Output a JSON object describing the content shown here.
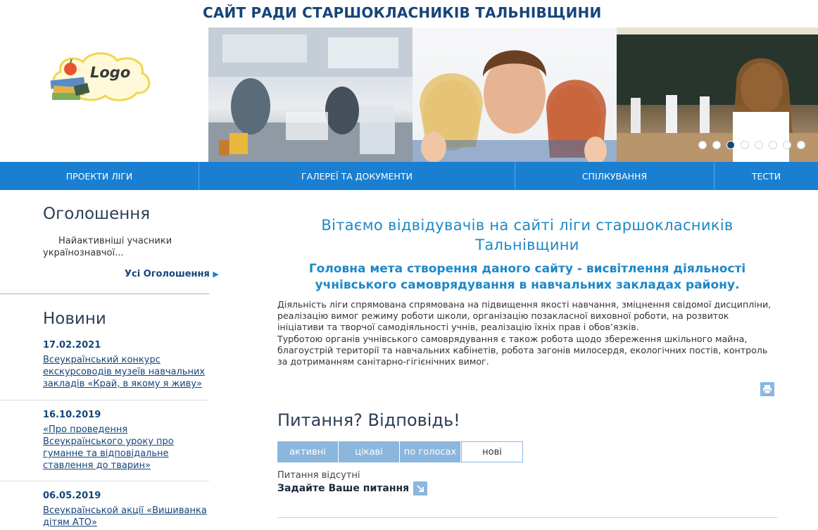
{
  "header": {
    "site_title": "САЙТ РАДИ СТАРШОКЛАСНИКІВ ТАЛЬНІВЩИНИ",
    "logo_text": "Logo"
  },
  "slider": {
    "dots_count": 8,
    "active_index": 3
  },
  "nav": [
    {
      "label": "ПРОЕКТИ ЛІГИ"
    },
    {
      "label": "ГАЛЕРЕЇ ТА ДОКУМЕНТИ"
    },
    {
      "label": "СПІЛКУВАННЯ"
    },
    {
      "label": "ТЕСТИ"
    }
  ],
  "announcements": {
    "title": "Оголошення",
    "text": "Найактивніші учасники українознавчої...",
    "all_link": "Усі Оголошення"
  },
  "news": {
    "title": "Новини",
    "items": [
      {
        "date": "17.02.2021",
        "text": "Всеукраїнський конкурс екскурсоводів музеїв навчальних закладів «Край, в якому я живу»"
      },
      {
        "date": "16.10.2019",
        "text": "«Про проведення Всеукраїнського уроку про гуманне та відповідальне ставлення до тварин»"
      },
      {
        "date": "06.05.2019",
        "text": "Всеукраїнськой акції «Вишиванка дітям АТО»"
      }
    ]
  },
  "main": {
    "welcome": "Вітаємо відвідувачів на сайті ліги старшокласників Тальнівщини",
    "goal": "Головна мета створення даного сайту - висвітлення діяльності учнівського самоврядування в навчальних закладах району.",
    "desc_1": "Діяльність ліги спрямована спрямована на підвищення якості навчання, зміцнення свідомої дисципліни, реалізацію вимог режиму роботи школи, організацію позакласної виховної роботи, на розвиток ініціативи та творчої самодіяльності учнів, реалізацію їхніх прав і обов’язків.",
    "desc_2": "Турботою органів учнівського самоврядування є також робота щодо збереження шкільного майна, благоустрій території та навчальних кабінетів, робота загонів милосердя, екологічних постів, контроль за дотриманням санітарно-гігієнічних вимог."
  },
  "qa": {
    "title": "Питання? Відповідь!",
    "tabs": [
      {
        "label": "активні"
      },
      {
        "label": "цікаві"
      },
      {
        "label": "по голосах"
      },
      {
        "label": "нові"
      }
    ],
    "selected_tab": "нові",
    "no_questions": "Питання відсутні",
    "ask_link": "Задайте Ваше питання"
  },
  "colors": {
    "nav_bg": "#1a7fd1",
    "title_blue": "#16457a",
    "accent_blue": "#1e88c7",
    "tab_bg": "#8bb6dd"
  }
}
